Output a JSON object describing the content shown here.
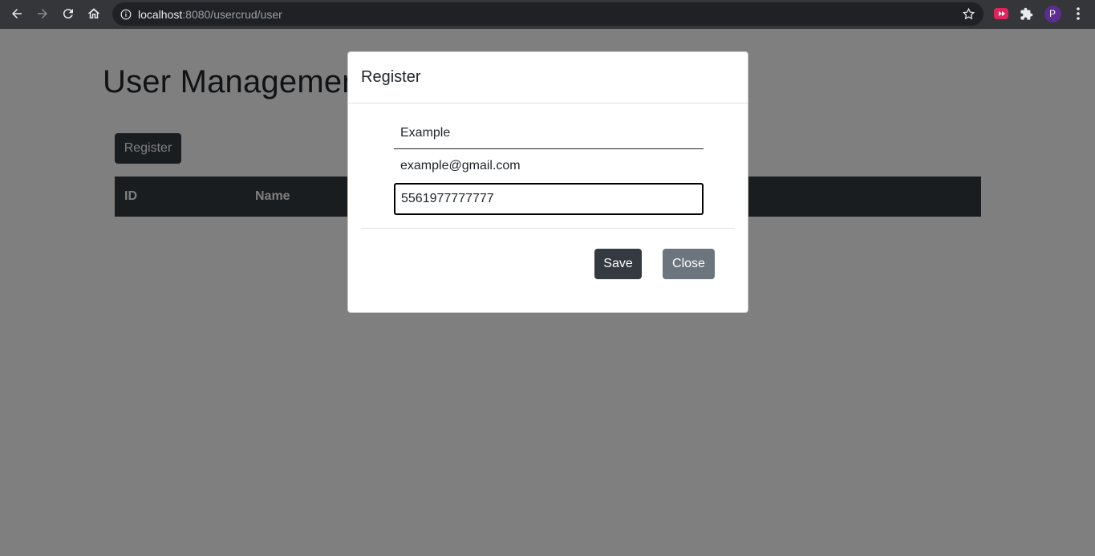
{
  "browser": {
    "url_host": "localhost",
    "url_rest": ":8080/usercrud/user",
    "profile_initial": "P"
  },
  "page": {
    "title": "User Management",
    "register_button": "Register",
    "table_headers": [
      "ID",
      "Name"
    ]
  },
  "modal": {
    "title": "Register",
    "fields": {
      "name": "Example",
      "email": "example@gmail.com",
      "phone": "5561977777777"
    },
    "save_label": "Save",
    "close_label": "Close"
  },
  "colors": {
    "dark": "#343a40",
    "secondary": "#6c757d",
    "chrome": "#35363a"
  }
}
